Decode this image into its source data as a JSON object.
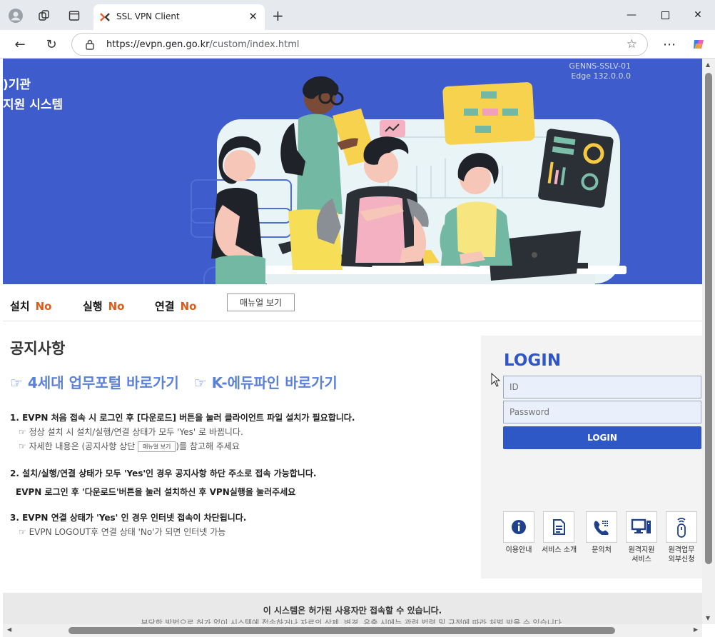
{
  "browser": {
    "tab_title": "SSL VPN Client",
    "url_host": "https://evpn.gen.go.kr",
    "url_path": "/custom/index.html",
    "icons": [
      "profile-icon",
      "workspaces-icon",
      "tab-actions-icon",
      "close-icon",
      "new-tab-icon",
      "minimize-icon",
      "maximize-icon",
      "window-close-icon",
      "back-icon",
      "refresh-icon",
      "lock-icon",
      "favorite-star-icon",
      "more-icon",
      "copilot-icon"
    ]
  },
  "hero": {
    "title_line1": ")기관",
    "title_line2": "지원 시스템",
    "version_line1": "GENNS-SSLV-01",
    "version_line2": "Edge 132.0.0.0"
  },
  "status": {
    "install_label": "설치",
    "install_value": "No",
    "run_label": "실행",
    "run_value": "No",
    "connect_label": "연결",
    "connect_value": "No",
    "manual_button": "매뉴얼 보기"
  },
  "notice": {
    "title": "공지사항",
    "link1": "☞ 4세대 업무포털 바로가기",
    "link2": "☞ K-에듀파인 바로가기",
    "item1": "1. EVPN 처음 접속 시 로그인 후 [다운로드] 버튼을 눌러 클라이언트 파일 설치가 필요합니다.",
    "item1_sub1": "☞ 정상 설치 시 설치/실행/연결 상태가 모두 'Yes' 로 바뀝니다.",
    "item1_sub2_pre": "☞ 자세한 내용은 (공지사항 상단 ",
    "item1_sub2_btn": "매뉴얼 보기",
    "item1_sub2_post": ")를 참고해 주세요",
    "item2": "2. 설치/실행/연결 상태가 모두 'Yes'인 경우 공지사항 하단 주소로 접속 가능합니다.",
    "item2_sub": "EVPN 로그인 후 '다운로드'버튼을 눌러 설치하신 후 VPN실행을 눌러주세요",
    "item3": "3. EVPN 연결 상태가 'Yes' 인 경우 인터넷 접속이 차단됩니다.",
    "item3_sub": "☞ EVPN LOGOUT후 연결 상태 'No'가 되면 인터넷 가능"
  },
  "login": {
    "title": "LOGIN",
    "id_placeholder": "ID",
    "password_placeholder": "Password",
    "button": "LOGIN",
    "services": [
      {
        "label": "이용안내",
        "icon": "info-icon"
      },
      {
        "label": "서비스 소개",
        "icon": "document-icon"
      },
      {
        "label": "문의처",
        "icon": "phone-icon"
      },
      {
        "label": "원격지원\n서비스",
        "icon": "remote-support-icon"
      },
      {
        "label": "원격업무\n외부신청",
        "icon": "remote-device-icon"
      }
    ]
  },
  "footer": {
    "text": "이 시스템은 허가된 사용자만 접속할 수 있습니다.",
    "subtext": "부당한 방법으로 허가 없이 시스템에 접속하거나 자료의 삭제, 변경, 유출 시에는 관련 법령 및 규정에 따라 처벌 받을 수 있습니다."
  },
  "colors": {
    "hero_bg": "#3e5ccc",
    "accent": "#2f58c7",
    "status_no": "#e05a1a",
    "link": "#5a80d8"
  }
}
